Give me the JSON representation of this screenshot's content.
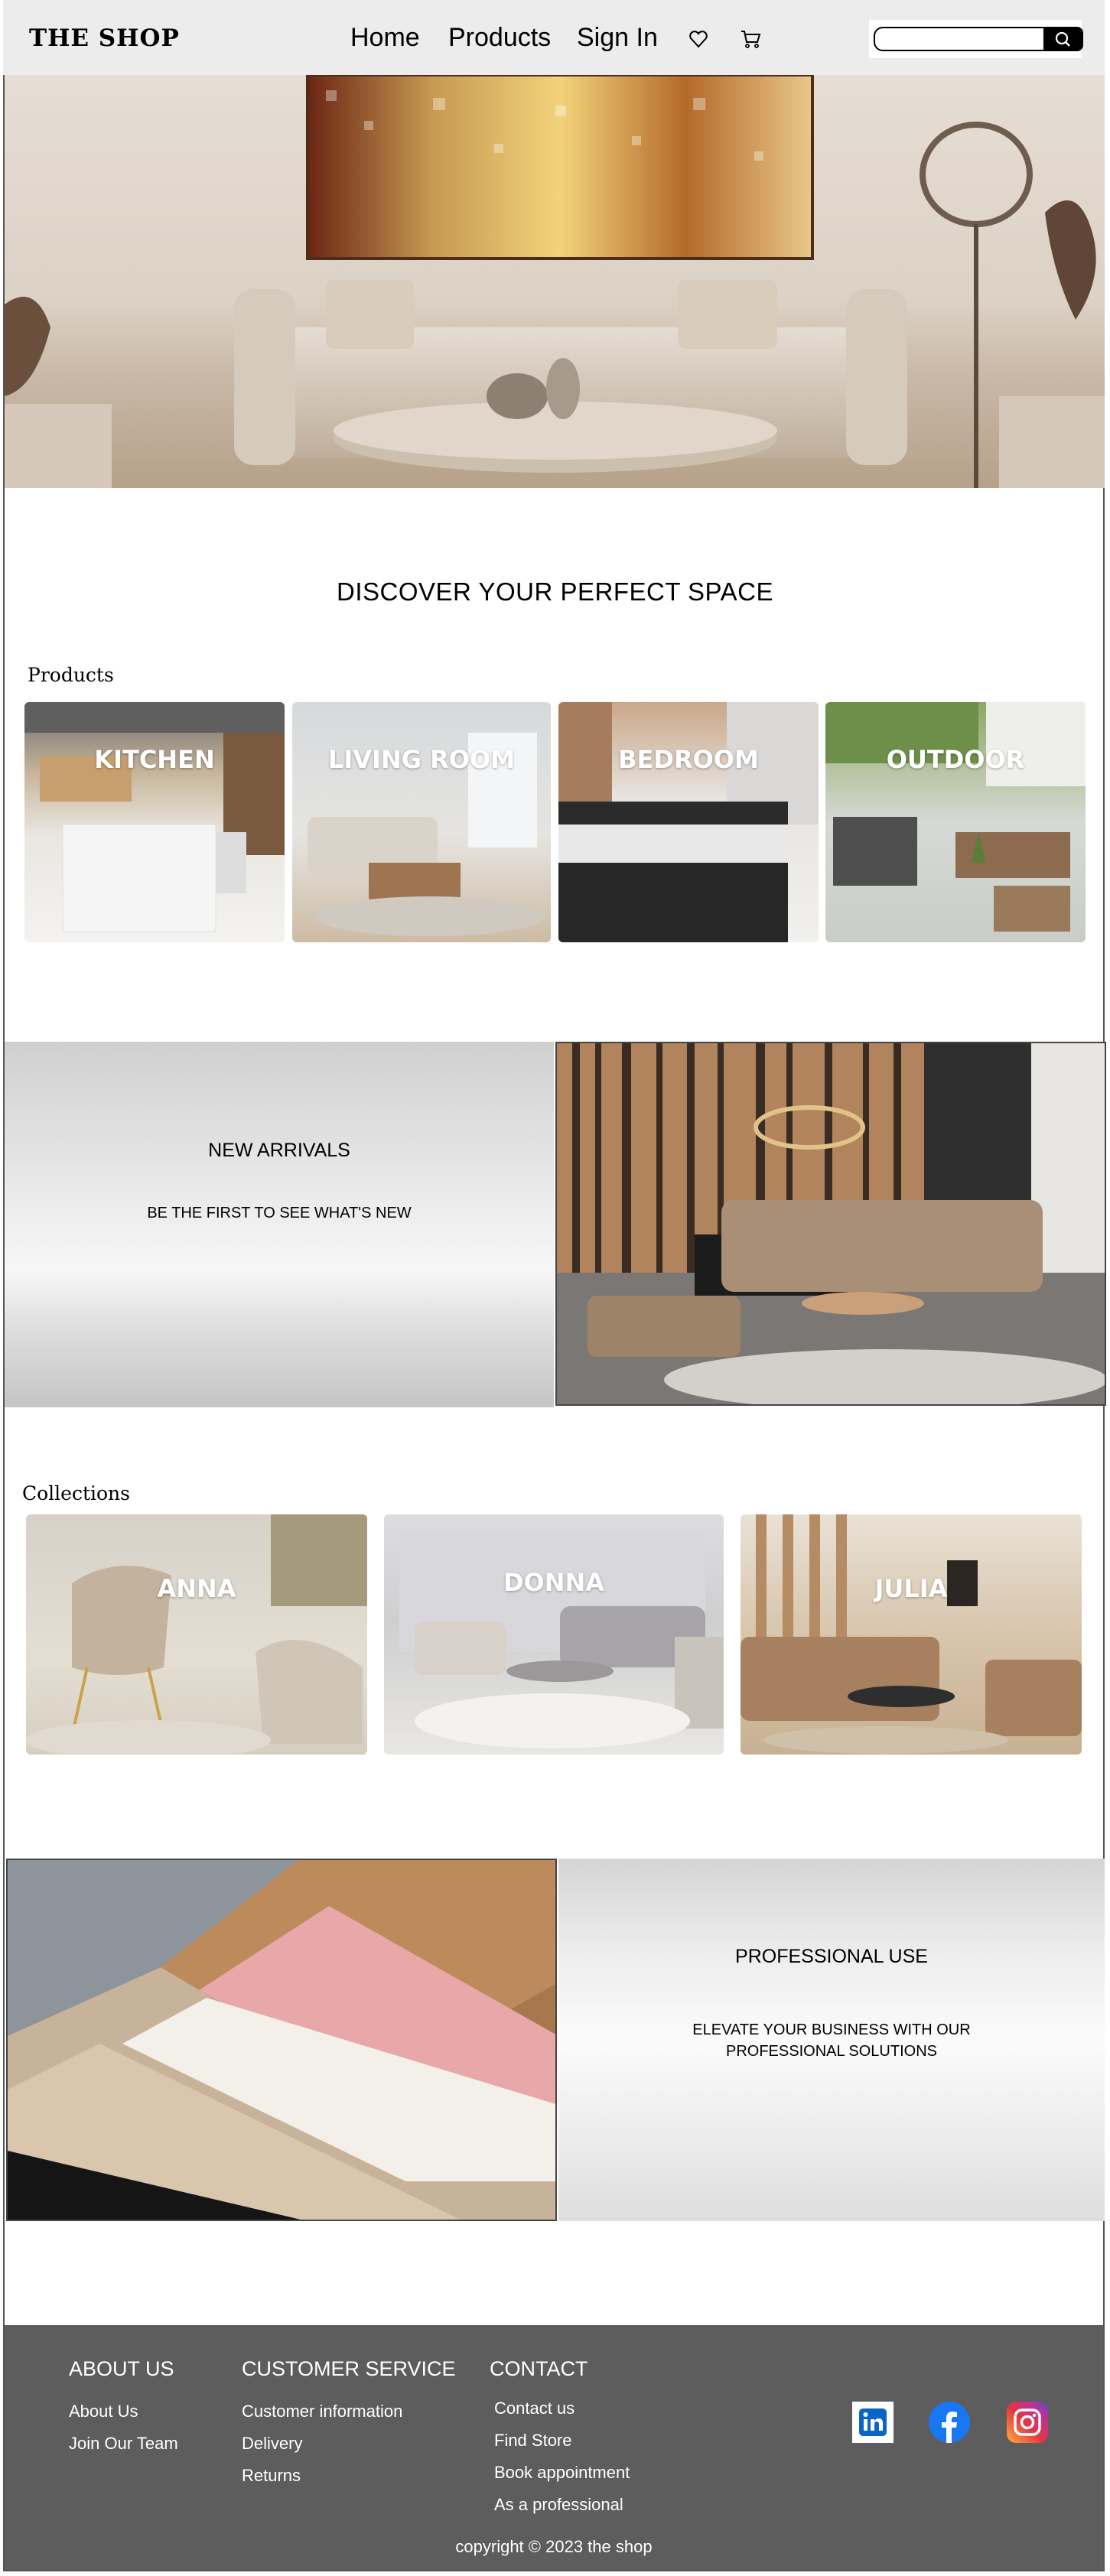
{
  "header": {
    "logo": "THE SHOP",
    "nav": {
      "home": "Home",
      "products": "Products",
      "sign_in": "Sign In"
    },
    "search": {
      "placeholder": "",
      "value": ""
    }
  },
  "main": {
    "heading": "DISCOVER YOUR PERFECT SPACE",
    "products_label": "Products",
    "product_cards": [
      {
        "label": "KITCHEN"
      },
      {
        "label": "LIVING ROOM"
      },
      {
        "label": "BEDROOM"
      },
      {
        "label": "OUTDOOR"
      }
    ],
    "new_arrivals": {
      "title": "NEW ARRIVALS",
      "subtitle": "BE THE FIRST TO SEE WHAT'S NEW"
    },
    "collections_label": "Collections",
    "collection_cards": [
      {
        "label": "ANNA"
      },
      {
        "label": "DONNA"
      },
      {
        "label": "JULIA"
      }
    ],
    "professional": {
      "title": "PROFESSIONAL USE",
      "subtitle_line1": "ELEVATE YOUR BUSINESS WITH OUR",
      "subtitle_line2": "PROFESSIONAL SOLUTIONS"
    }
  },
  "footer": {
    "about": {
      "heading": "ABOUT US",
      "links": [
        "About Us",
        "Join Our Team"
      ]
    },
    "customer_service": {
      "heading": "CUSTOMER SERVICE",
      "links": [
        "Customer information",
        "Delivery",
        "Returns"
      ]
    },
    "contact": {
      "heading": "CONTACT",
      "links": [
        "Contact us",
        "Find Store",
        "Book appointment",
        "As a professional"
      ]
    },
    "social": [
      "linkedin-icon",
      "facebook-icon",
      "instagram-icon"
    ],
    "copyright": "copyright © 2023 the shop"
  },
  "colors": {
    "header_bg": "#ececec",
    "footer_bg": "#5d5d5d",
    "facebook": "#1877f2",
    "linkedin": "#0a66c2"
  }
}
